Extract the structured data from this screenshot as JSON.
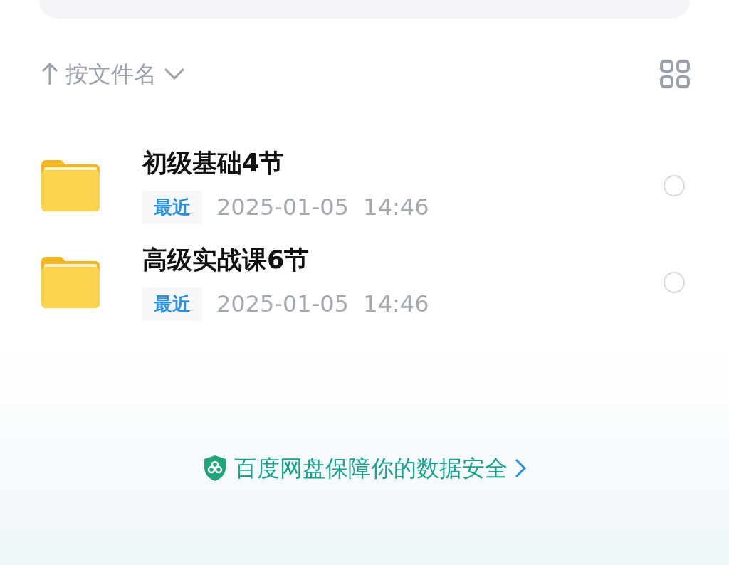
{
  "sort": {
    "label": "按文件名"
  },
  "files": [
    {
      "name": "初级基础4节",
      "tag": "最近",
      "date": "2025-01-05  14:46",
      "selected": false
    },
    {
      "name": "高级实战课6节",
      "tag": "最近",
      "date": "2025-01-05  14:46",
      "selected": false
    }
  ],
  "footer": {
    "text": "百度网盘保障你的数据安全"
  }
}
